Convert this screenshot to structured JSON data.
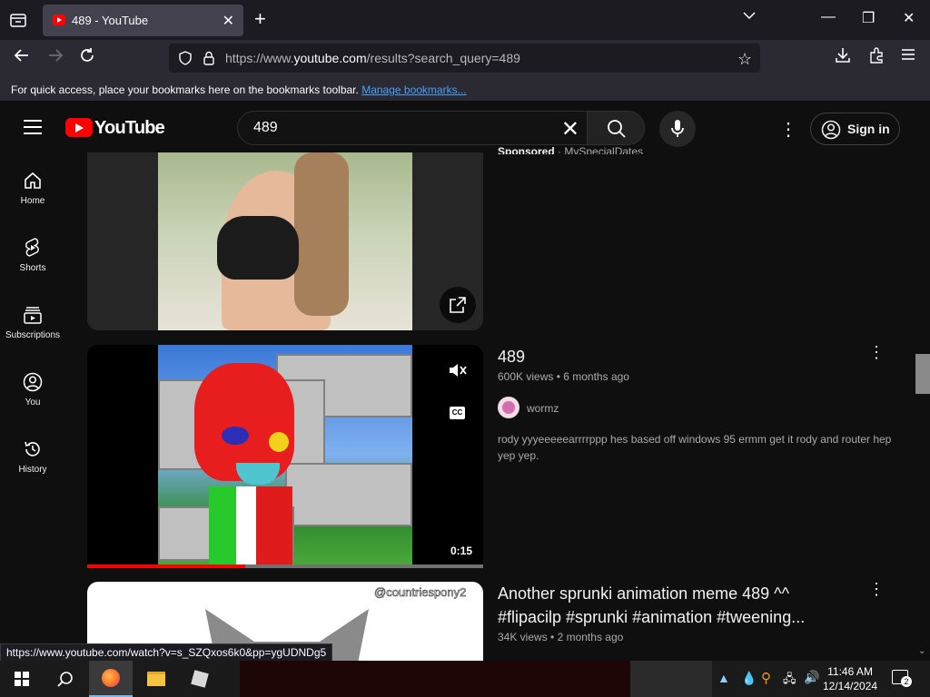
{
  "browser": {
    "tab_title": "489 - YouTube",
    "url_prefix": "https://www.",
    "url_domain": "youtube.com",
    "url_path": "/results?search_query=489",
    "bookmarks_message": "For quick access, place your bookmarks here on the bookmarks toolbar.",
    "bookmarks_link": "Manage bookmarks..."
  },
  "youtube": {
    "logo_text": "YouTube",
    "search_query": "489",
    "sign_in": "Sign in",
    "sidebar": [
      {
        "label": "Home",
        "icon": "home-icon"
      },
      {
        "label": "Shorts",
        "icon": "shorts-icon"
      },
      {
        "label": "Subscriptions",
        "icon": "subscriptions-icon"
      },
      {
        "label": "You",
        "icon": "you-icon"
      },
      {
        "label": "History",
        "icon": "history-icon"
      }
    ]
  },
  "results": {
    "sponsored": {
      "label": "Sponsored",
      "channel": "MySpecialDates"
    },
    "video1": {
      "title": "489",
      "views": "600K views",
      "age": "6 months ago",
      "channel": "wormz",
      "description": "rody yyyeeeeearrrrppp hes based off windows 95 ermm get it rody and router hep yep yep.",
      "duration": "0:15",
      "progress": 0.4
    },
    "video2": {
      "title_line1": "Another sprunki animation meme 489 ^^",
      "title_line2": "#flipacilp #sprunki #animation #tweening...",
      "views": "34K views",
      "age": "2 months ago",
      "watermark": "@countriespony2"
    }
  },
  "status_link": "https://www.youtube.com/watch?v=s_SZQxos6k0&pp=ygUDNDg5",
  "taskbar": {
    "time": "11:46 AM",
    "date": "12/14/2024",
    "notifications": "2"
  },
  "colors": {
    "youtube_red": "#ff0000",
    "page_bg": "#0f0f0f",
    "link_blue": "#45a1ff"
  }
}
